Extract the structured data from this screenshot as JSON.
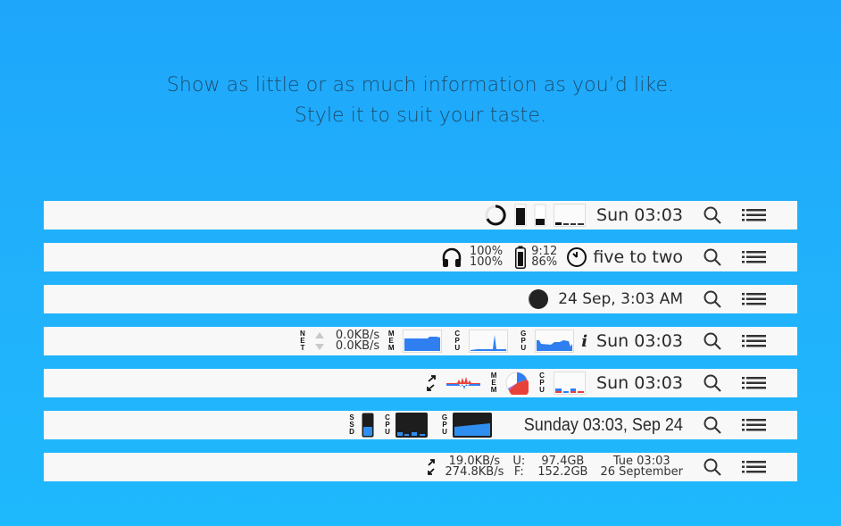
{
  "headline": {
    "line1": "Show as little or as much information as you’d like.",
    "line2": "Style it to suit your taste."
  },
  "colors": {
    "background": "#1ea6fb",
    "bar": "#f8f8f8",
    "accent_blue": "#2f7ff0",
    "accent_red": "#e8413a"
  },
  "bars": [
    {
      "clock": "Sun 03:03",
      "icons": [
        "cpu-ring-icon",
        "memory-bar-icon",
        "disk-bar-icon",
        "cpu-history-icon"
      ]
    },
    {
      "headphones_top": "100%",
      "headphones_bottom": "100%",
      "battery_time": "9:12",
      "battery_percent": "86%",
      "clock": "five to two"
    },
    {
      "clock": "24 Sep, 3:03 AM",
      "icons": [
        "moon-phase-icon"
      ]
    },
    {
      "net_label": "NET",
      "net_up": "0.0KB/s",
      "net_down": "0.0KB/s",
      "mem_label": "MEM",
      "cpu_label": "CPU",
      "gpu_label": "GPU",
      "info_label": "i",
      "clock": "Sun 03:03"
    },
    {
      "mem_label": "MEM",
      "cpu_label": "CPU",
      "clock": "Sun 03:03",
      "mem_pie": {
        "used_fraction": 0.7
      }
    },
    {
      "ssd_label": "SSD",
      "cpu_label": "CPU",
      "gpu_label": "GPU",
      "clock": "Sunday 03:03, Sep 24",
      "ssd_fill": 0.4
    },
    {
      "net_up": "19.0KB/s",
      "net_down": "274.8KB/s",
      "disk_used_label": "U:",
      "disk_used": "97.4GB",
      "disk_free_label": "F:",
      "disk_free": "152.2GB",
      "clock_top": "Tue 03:03",
      "clock_bottom": "26 September"
    }
  ]
}
